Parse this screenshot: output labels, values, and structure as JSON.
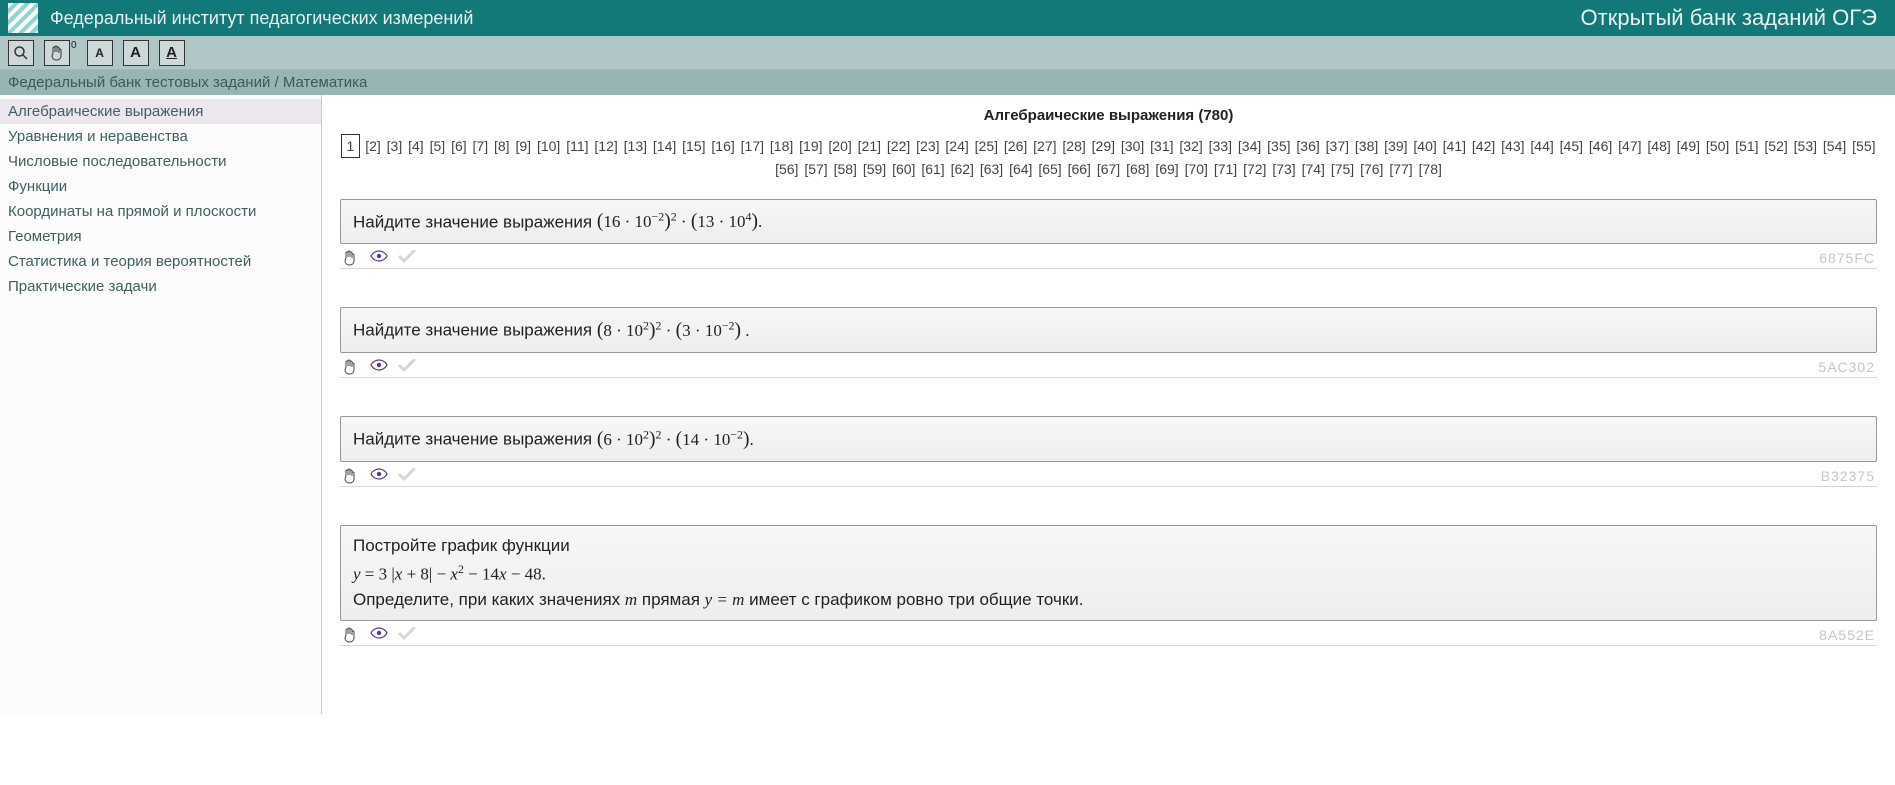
{
  "header": {
    "title": "Федеральный институт педагогических измерений",
    "right": "Открытый банк заданий ОГЭ"
  },
  "toolbar": {
    "hand_sup": "0",
    "font_a": "A",
    "font_b": "A",
    "font_c": "A"
  },
  "breadcrumb": "Федеральный банк тестовых заданий / Математика",
  "sidebar": {
    "items": [
      "Алгебраические выражения",
      "Уравнения и неравенства",
      "Числовые последовательности",
      "Функции",
      "Координаты на прямой и плоскости",
      "Геометрия",
      "Статистика и теория вероятностей",
      "Практические задачи"
    ],
    "active_index": 0
  },
  "page_title": "Алгебраические выражения (780)",
  "pagination": {
    "current": 1,
    "total_pages": 78
  },
  "tasks": [
    {
      "prompt": "Найдите значение выражения ",
      "formula_html": "<span class='big-paren'>(</span>16 · 10<sup>−2</sup><span class='big-paren'>)</span><sup>2</sup> · <span class='big-paren'>(</span>13 · 10<sup>4</sup><span class='big-paren'>)</span>.",
      "id": "6875FC"
    },
    {
      "prompt": "Найдите значение выражения ",
      "formula_html": "<span class='big-paren'>(</span>8 · 10<sup>2</sup><span class='big-paren'>)</span><sup>2</sup> · <span class='big-paren'>(</span>3 · 10<sup>−2</sup><span class='big-paren'>)</span> .",
      "id": "5AC302"
    },
    {
      "prompt": "Найдите значение выражения ",
      "formula_html": "<span class='big-paren'>(</span>6 · 10<sup>2</sup><span class='big-paren'>)</span><sup>2</sup> · <span class='big-paren'>(</span>14 · 10<sup>−2</sup><span class='big-paren'>)</span>.",
      "id": "B32375"
    },
    {
      "line1": "Постройте график функции",
      "formula_html": "<span class='italic'>y</span> = 3 |<span class='italic'>x</span> + 8| − <span class='italic'>x</span><sup>2</sup> − 14<span class='italic'>x</span> − 48.",
      "line3_pre": "Определите, при каких значениях ",
      "line3_mid1": "m",
      "line3_mid2": " прямая ",
      "line3_mid3": "y = m",
      "line3_post": " имеет с графиком ровно три общие точки.",
      "id": "8A552E"
    }
  ]
}
